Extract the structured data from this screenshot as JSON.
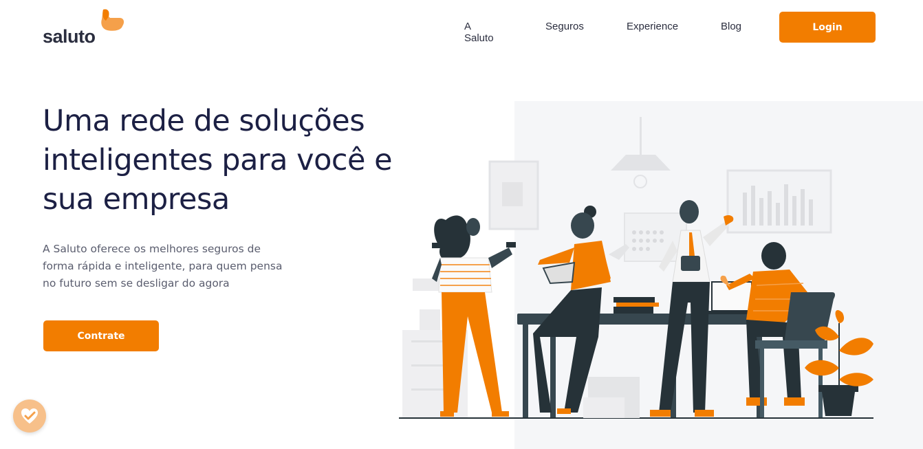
{
  "header": {
    "logo_text": "saluto",
    "nav": [
      {
        "label": "A Saluto"
      },
      {
        "label": "Seguros"
      },
      {
        "label": "Experience"
      },
      {
        "label": "Blog"
      }
    ],
    "login_label": "Login"
  },
  "hero": {
    "title": "Uma rede de soluções inteligentes para você e sua empresa",
    "description": "A Saluto oferece os melhores seguros de forma rápida e inteligente, para quem pensa no futuro sem se desligar do agora",
    "cta_label": "Contrate"
  },
  "colors": {
    "accent": "#f27d00",
    "accent_light": "#f5a04a",
    "title": "#1c2044",
    "illustration_bg": "#f5f6f8",
    "dark": "#263238"
  },
  "icons": {
    "badge": "check-heart-icon"
  }
}
